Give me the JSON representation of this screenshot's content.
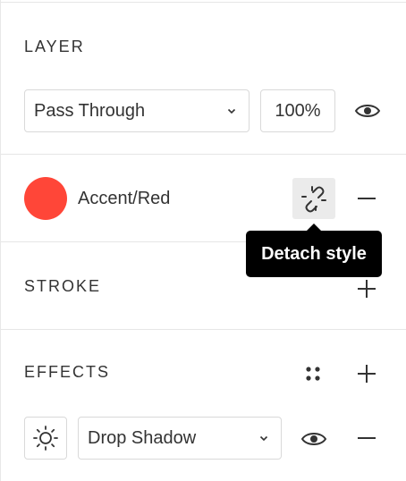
{
  "layer": {
    "title": "LAYER",
    "blend_mode": "Pass Through",
    "opacity": "100%"
  },
  "fill": {
    "style_name": "Accent/Red",
    "swatch_color": "#ff4638",
    "tooltip": "Detach style"
  },
  "stroke": {
    "title": "STROKE"
  },
  "effects": {
    "title": "EFFECTS",
    "effect_type": "Drop Shadow"
  },
  "colors": {
    "text": "#333333",
    "border": "#d9d9d9",
    "divider": "#e6e6e6",
    "hover_bg": "#ebebeb",
    "tooltip_bg": "#000000"
  },
  "icons": [
    "chevron-down-icon",
    "eye-icon",
    "detach-link-icon",
    "minus-icon",
    "plus-icon",
    "style-grid-icon",
    "sun-icon"
  ]
}
